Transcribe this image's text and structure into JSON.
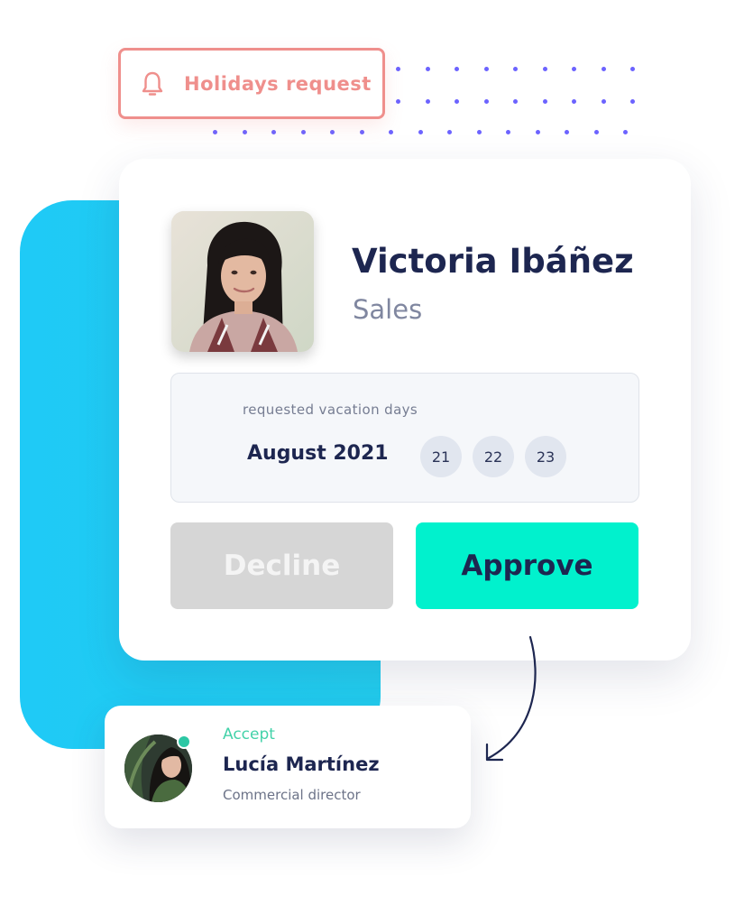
{
  "colors": {
    "accent_blue": "#1fcaf6",
    "tag_coral": "#ef8f8c",
    "dots_purple": "#6c63ff",
    "approve_mint": "#01f1cd",
    "decline_gray": "#d6d6d6",
    "navy_text": "#1d2650",
    "accept_green": "#43d2a9"
  },
  "notification_tag": {
    "icon": "bell-icon",
    "label": "Holidays request"
  },
  "request": {
    "employee": {
      "name": "Victoria Ibáñez",
      "department": "Sales",
      "avatar": "employee-photo"
    },
    "days_caption": "requested vacation days",
    "month": "August 2021",
    "days": [
      "21",
      "22",
      "23"
    ]
  },
  "actions": {
    "decline_label": "Decline",
    "approve_label": "Approve"
  },
  "approver": {
    "status": "Accept",
    "name": "Lucía Martínez",
    "role": "Commercial director",
    "avatar": "approver-photo"
  }
}
